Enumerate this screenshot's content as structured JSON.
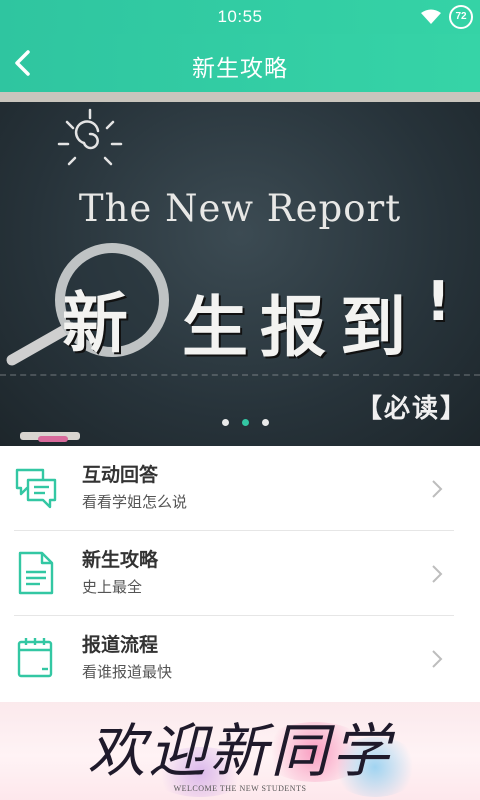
{
  "status_bar": {
    "time": "10:55",
    "battery_level": "72",
    "wifi_icon": "wifi-icon"
  },
  "app_bar": {
    "back_icon": "chevron-left-icon",
    "title": "新生攻略"
  },
  "banner": {
    "headline": "The New Report",
    "big_title": [
      "新",
      "生",
      "报",
      "到",
      "!"
    ],
    "tag": "【必读】",
    "page_indicator": {
      "count": 3,
      "active_index": 1
    }
  },
  "menu": {
    "items": [
      {
        "icon": "chat-bubble-icon",
        "label": "互动回答",
        "sub": "看看学姐怎么说"
      },
      {
        "icon": "document-icon",
        "label": "新生攻略",
        "sub": "史上最全"
      },
      {
        "icon": "calendar-icon",
        "label": "报道流程",
        "sub": "看谁报道最快"
      }
    ],
    "chevron_icon": "chevron-right-icon"
  },
  "footer": {
    "title": "欢迎新同学",
    "subtitle": "WELCOME THE NEW STUDENTS"
  },
  "colors": {
    "accent": "#33c7a3",
    "text_primary": "#333333",
    "text_secondary": "#555555"
  }
}
